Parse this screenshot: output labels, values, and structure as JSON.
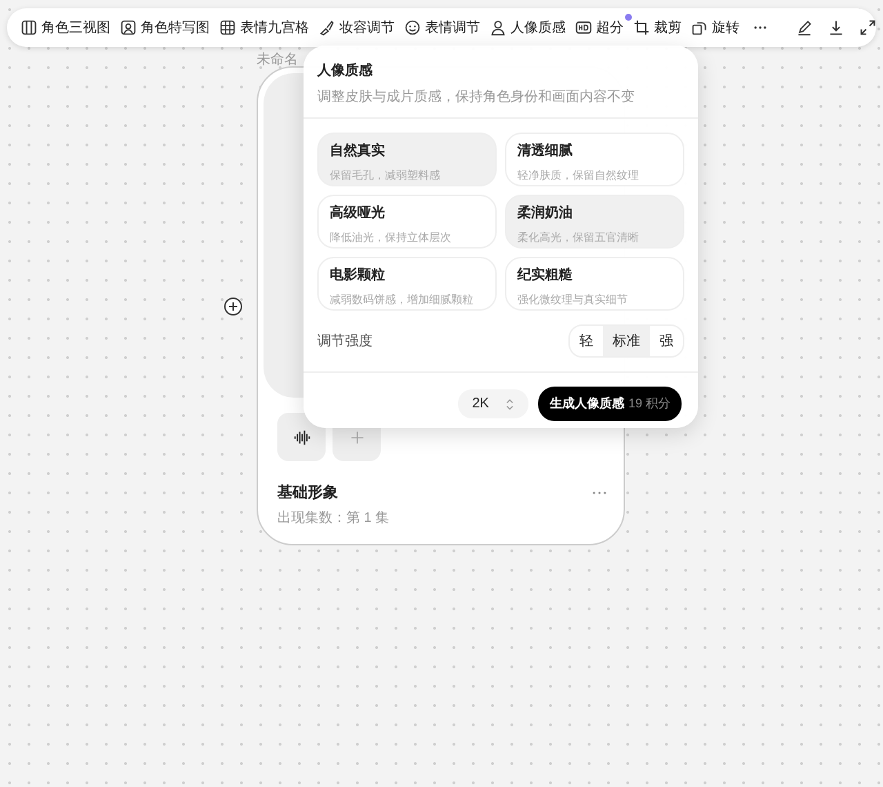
{
  "toolbar": {
    "items": [
      {
        "label": "角色三视图",
        "badge": false
      },
      {
        "label": "角色特写图",
        "badge": false
      },
      {
        "label": "表情九宫格",
        "badge": false
      },
      {
        "label": "妆容调节",
        "badge": false
      },
      {
        "label": "表情调节",
        "badge": false
      },
      {
        "label": "人像质感",
        "badge": false
      },
      {
        "label": "超分",
        "badge": true
      },
      {
        "label": "裁剪",
        "badge": false
      },
      {
        "label": "旋转",
        "badge": false
      }
    ]
  },
  "card": {
    "label": "未命名",
    "title": "基础形象",
    "subtitle": "出现集数：第 1 集"
  },
  "panel": {
    "title": "人像质感",
    "description": "调整皮肤与成片质感，保持角色身份和画面内容不变",
    "options": [
      {
        "name": "自然真实",
        "desc": "保留毛孔，减弱塑料感",
        "selected": true
      },
      {
        "name": "清透细腻",
        "desc": "轻净肤质，保留自然纹理",
        "selected": false
      },
      {
        "name": "高级哑光",
        "desc": "降低油光，保持立体层次",
        "selected": false
      },
      {
        "name": "柔润奶油",
        "desc": "柔化高光，保留五官清晰",
        "selected": true
      },
      {
        "name": "电影颗粒",
        "desc": "减弱数码饼感，增加细腻颗粒",
        "selected": false
      },
      {
        "name": "纪实粗糙",
        "desc": "强化微纹理与真实细节",
        "selected": false
      }
    ],
    "intensity_label": "调节强度",
    "intensity": [
      {
        "label": "轻",
        "selected": false
      },
      {
        "label": "标准",
        "selected": true
      },
      {
        "label": "强",
        "selected": false
      }
    ],
    "resolution": "2K",
    "generate": {
      "label": "生成人像质感",
      "cost": "19 积分"
    }
  }
}
